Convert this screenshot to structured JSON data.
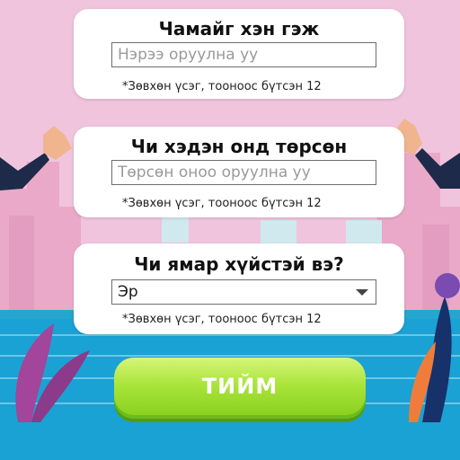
{
  "name_card": {
    "title": "Чамайг хэн гэж",
    "placeholder": "Нэрээ оруулна уу",
    "hint": "*Зөвхөн үсэг, тооноос бүтсэн 12"
  },
  "birth_card": {
    "title": "Чи хэдэн онд төрсөн",
    "placeholder": "Төрсөн оноо оруулна уу",
    "hint": "*Зөвхөн үсэг, тооноос бүтсэн 12"
  },
  "gender_card": {
    "title": "Чи ямар хүйстэй вэ?",
    "selected": "Эр",
    "hint": "*Зөвхөн үсэг, тооноос бүтсэн 12"
  },
  "submit": {
    "label": "ТИЙМ"
  },
  "colors": {
    "background": "#f0c4dc",
    "water": "#1aa2d4",
    "button": "#a9e43a"
  }
}
